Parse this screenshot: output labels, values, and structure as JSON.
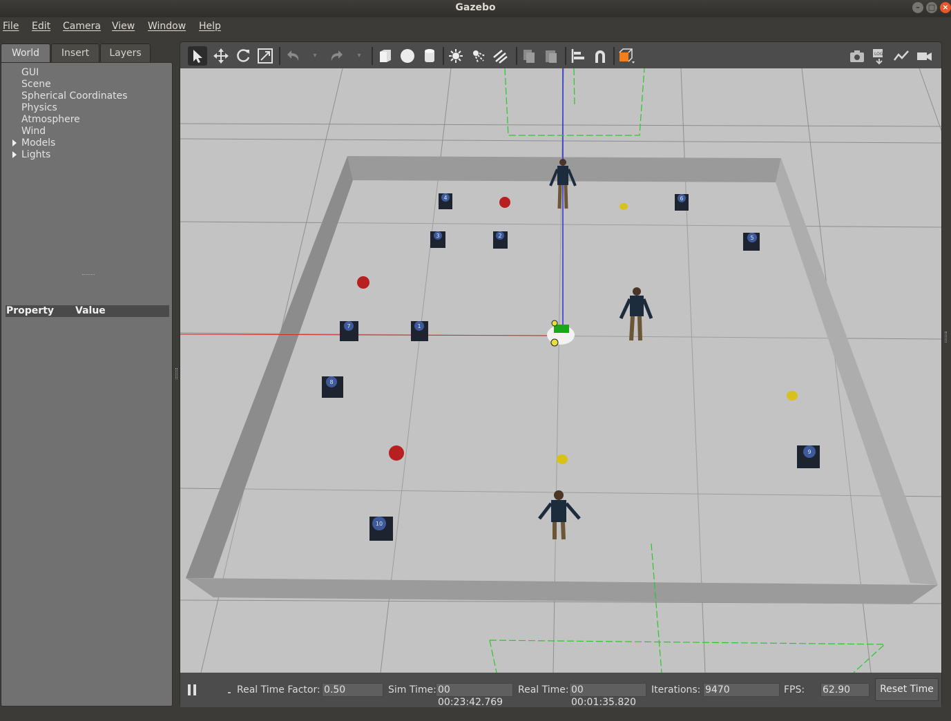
{
  "window": {
    "title": "Gazebo"
  },
  "menu": {
    "file": "File",
    "edit": "Edit",
    "camera": "Camera",
    "view": "View",
    "window": "Window",
    "help": "Help"
  },
  "left_panel": {
    "tabs": [
      "World",
      "Insert",
      "Layers"
    ],
    "active_tab": "World",
    "tree_items": [
      "GUI",
      "Scene",
      "Spherical Coordinates",
      "Physics",
      "Atmosphere",
      "Wind",
      "Models",
      "Lights"
    ],
    "property_header": {
      "property": "Property",
      "value": "Value"
    }
  },
  "toolbar": {
    "icons": [
      "select-arrow-icon",
      "translate-icon",
      "rotate-icon",
      "scale-icon",
      "undo-icon",
      "redo-icon",
      "box-shape-icon",
      "sphere-shape-icon",
      "cylinder-shape-icon",
      "point-light-icon",
      "spot-light-icon",
      "directional-light-icon",
      "copy-icon",
      "paste-icon",
      "align-icon",
      "magnet-snap-icon",
      "view-angle-icon",
      "screenshot-icon",
      "log-icon",
      "plot-icon",
      "record-video-icon"
    ],
    "accent_color": "#f07f1c"
  },
  "scene": {
    "floor_color": "#c3c3c3",
    "wall_color": "#9a9a9a",
    "cube_labels": [
      "1",
      "2",
      "3",
      "4",
      "5",
      "6",
      "7",
      "8",
      "9",
      "10"
    ],
    "colors": {
      "red_object": "#b81f1f",
      "yellow_object": "#d8c21a",
      "axis_x": "#d62828",
      "axis_z": "#2c2cdc",
      "frustum": "#28c828",
      "robot_marker": "#1aa81a"
    }
  },
  "status_bar": {
    "real_time_factor_label": "Real Time Factor:",
    "real_time_factor": "0.50",
    "sim_time_label": "Sim Time:",
    "sim_time": "00 00:23:42.769",
    "real_time_label": "Real Time:",
    "real_time": "00 00:01:35.820",
    "iterations_label": "Iterations:",
    "iterations": "9470",
    "fps_label": "FPS:",
    "fps": "62.90",
    "reset_label": "Reset Time"
  }
}
